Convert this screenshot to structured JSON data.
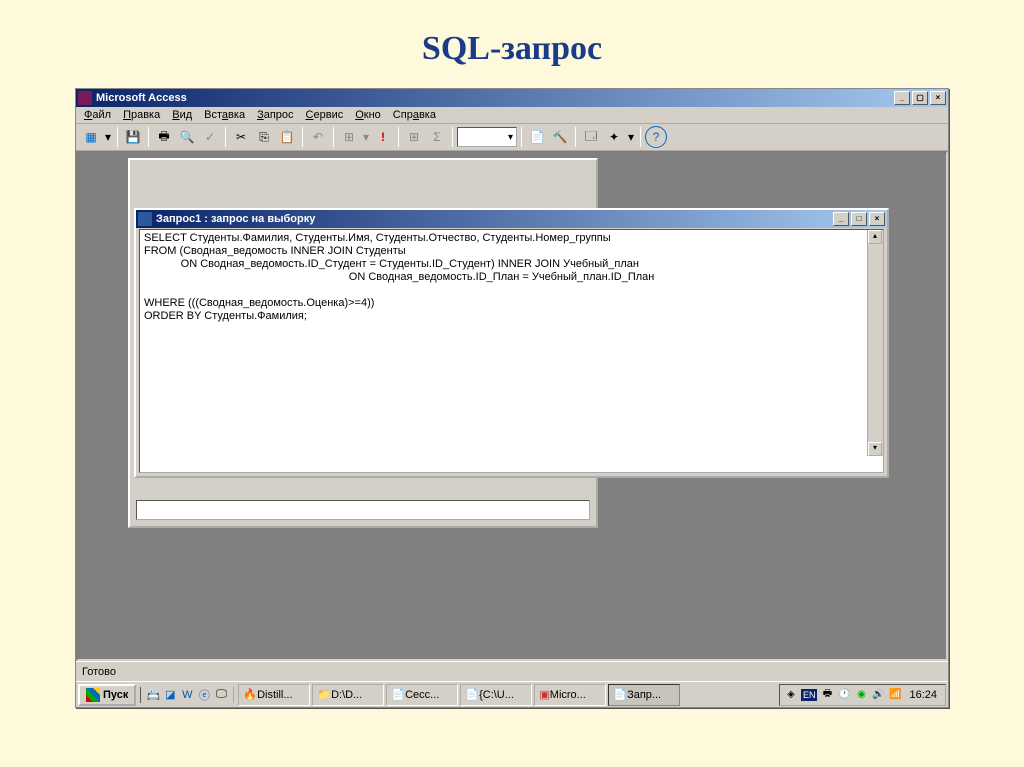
{
  "slide": {
    "title": "SQL-запрос"
  },
  "app": {
    "title": "Microsoft Access",
    "menus": [
      "Файл",
      "Правка",
      "Вид",
      "Вставка",
      "Запрос",
      "Сервис",
      "Окно",
      "Справка"
    ],
    "toolbar_icons": [
      "sql-view",
      "save",
      "print",
      "print-preview",
      "spell",
      "cut",
      "copy",
      "paste",
      "undo",
      "query-type",
      "run",
      "show-table",
      "totals",
      "top-values",
      "properties",
      "build",
      "db-window",
      "new-object",
      "help"
    ]
  },
  "sql_window": {
    "title": "Запрос1 : запрос на выборку",
    "sql": "SELECT Студенты.Фамилия, Студенты.Имя, Студенты.Отчество, Студенты.Номер_группы\nFROM (Сводная_ведомость INNER JOIN Студенты\n            ON Сводная_ведомость.ID_Студент = Студенты.ID_Студент) INNER JOIN Учебный_план\n                                                                   ON Сводная_ведомость.ID_План = Учебный_план.ID_План\n\nWHERE (((Сводная_ведомость.Оценка)>=4))\nORDER BY Студенты.Фамилия;"
  },
  "status": {
    "text": "Готово"
  },
  "taskbar": {
    "start": "Пуск",
    "tasks": [
      "Distill...",
      "D:\\D...",
      "Сесс...",
      "{C:\\U...",
      "Micro...",
      "Запр..."
    ],
    "lang": "EN",
    "clock": "16:24"
  }
}
